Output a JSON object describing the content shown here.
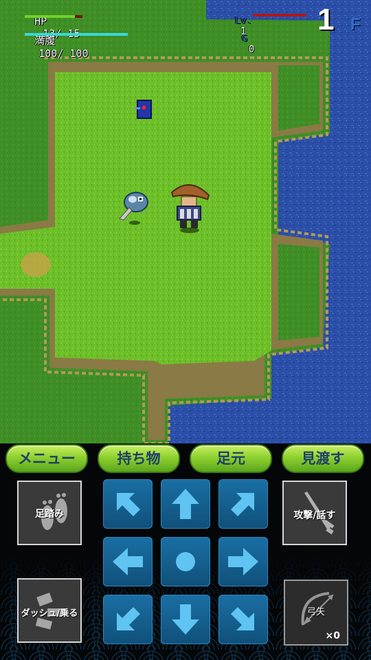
{
  "hud": {
    "hp_label": "HP",
    "hp_value": "13/ 15",
    "hp_fraction": 0.87,
    "fullness_label": "満腹",
    "fullness_value": "100/ 100",
    "fullness_fraction": 1.0,
    "level_label": "Lv.",
    "level_value": "1",
    "gold_label": "G",
    "gold_value": "0",
    "floor_number": "1",
    "floor_suffix": "F"
  },
  "tabs": [
    {
      "label": "メニュー"
    },
    {
      "label": "持ち物"
    },
    {
      "label": "足元"
    },
    {
      "label": "見渡す"
    }
  ],
  "side_buttons": {
    "step_label": "足踏み",
    "attack_label": "攻撃/話す",
    "dash_label": "ダッシュ/乗る",
    "arrow_label": "弓矢",
    "arrow_count": "×0"
  },
  "dpad": [
    "up-left",
    "up",
    "up-right",
    "left",
    "wait",
    "right",
    "down-left",
    "down",
    "down-right"
  ],
  "colors": {
    "hp_bar": "#6fd22a",
    "fullness_bar": "#38d7d7",
    "exp_bar": "#b01818",
    "tab_text": "#1d3f6a",
    "dpad_button": "#156496",
    "grass": "#6cbf28",
    "water": "#2b4fa8"
  },
  "sprites": {
    "player": "straw-hat-wanderer",
    "monster": "round-fish-monster",
    "item": "blue-scroll-icon"
  }
}
